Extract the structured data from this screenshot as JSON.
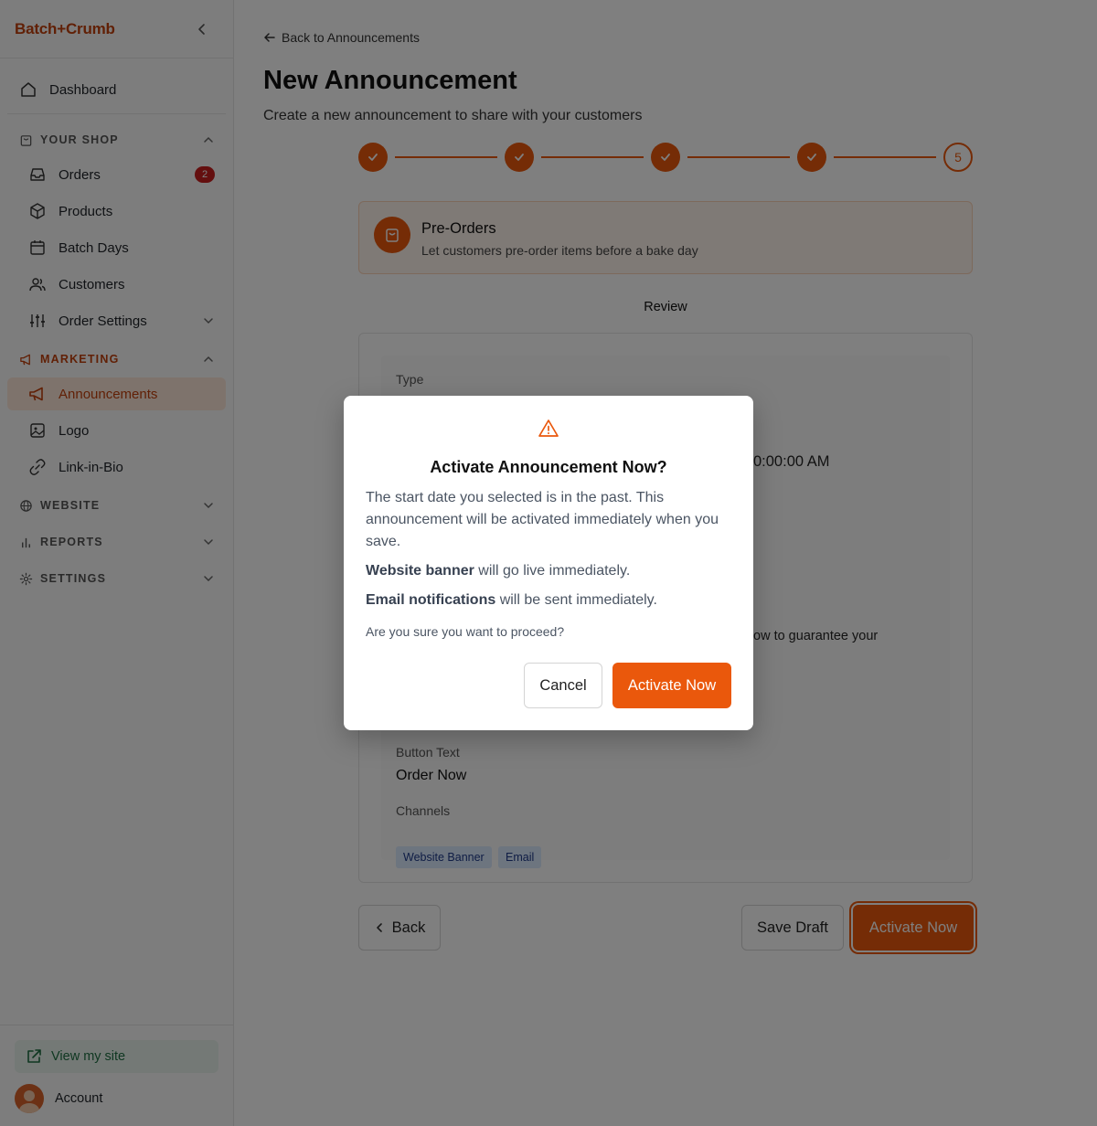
{
  "brand": "Batch+Crumb",
  "sidebar": {
    "dashboard": "Dashboard",
    "shop_section": "YOUR SHOP",
    "shop_items": [
      {
        "label": "Orders",
        "badge": "2"
      },
      {
        "label": "Products"
      },
      {
        "label": "Batch Days"
      },
      {
        "label": "Customers"
      },
      {
        "label": "Order Settings"
      }
    ],
    "marketing_section": "MARKETING",
    "marketing_items": [
      {
        "label": "Announcements"
      },
      {
        "label": "Logo"
      },
      {
        "label": "Link-in-Bio"
      }
    ],
    "website_section": "WEBSITE",
    "reports_section": "REPORTS",
    "settings_section": "SETTINGS",
    "view_site": "View my site",
    "account": "Account"
  },
  "page": {
    "back_link": "Back to Announcements",
    "title": "New Announcement",
    "subtitle": "Create a new announcement to share with your customers",
    "current_step": "5",
    "type_title": "Pre-Orders",
    "type_desc": "Let customers pre-order items before a bake day",
    "review_label": "Review",
    "review": {
      "type_label": "Type",
      "time_fragment": "0:00:00 AM",
      "text_fragment": "ow to guarantee your",
      "button_text_label": "Button Text",
      "button_text_value": "Order Now",
      "channels_label": "Channels",
      "channels": [
        "Website Banner",
        "Email"
      ]
    },
    "back_button": "Back",
    "save_draft_button": "Save Draft",
    "activate_button": "Activate Now"
  },
  "modal": {
    "title": "Activate Announcement Now?",
    "body": "The start date you selected is in the past. This announcement will be activated immediately when you save.",
    "banner_bold": "Website banner",
    "banner_rest": " will go live immediately.",
    "email_bold": "Email notifications",
    "email_rest": " will be sent immediately.",
    "confirm": "Are you sure you want to proceed?",
    "cancel_button": "Cancel",
    "activate_button": "Activate Now"
  },
  "colors": {
    "accent": "#ea580c",
    "brand": "#c2410c",
    "badge": "#c81e1e",
    "overlay": "rgba(0,0,0,0.5)"
  },
  "icons": {
    "collapse": "chevron-left-icon",
    "dashboard": "home-icon",
    "shop": "shopping-bag-icon",
    "orders": "inbox-icon",
    "products": "box-icon",
    "batch_days": "calendar-icon",
    "customers": "users-icon",
    "order_settings": "sliders-icon",
    "marketing": "megaphone-icon",
    "logo": "image-icon",
    "link": "link-icon",
    "website": "globe-icon",
    "reports": "bar-chart-icon",
    "settings": "gear-icon",
    "view_site": "external-link-icon",
    "warning": "warning-icon"
  }
}
